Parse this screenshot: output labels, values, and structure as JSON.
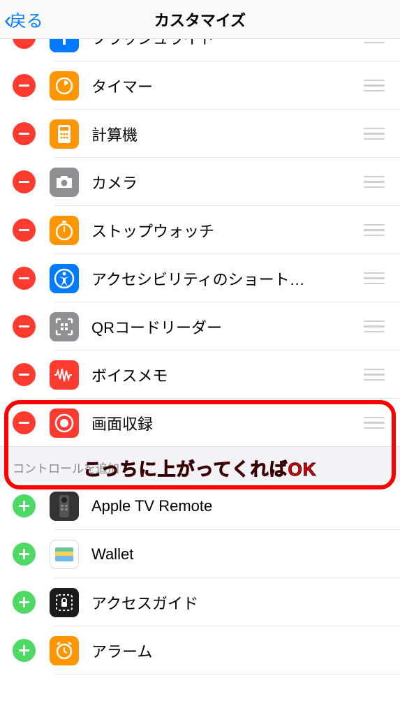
{
  "navbar": {
    "back": "戻る",
    "title": "カスタマイズ"
  },
  "callout_text": "こっちに上がってくればOK",
  "section_add_header": "コントロールを追加",
  "included": [
    {
      "label": "フラッシュライト",
      "icon": "flashlight",
      "bg": "ic-blue"
    },
    {
      "label": "タイマー",
      "icon": "timer",
      "bg": "ic-orange"
    },
    {
      "label": "計算機",
      "icon": "calculator",
      "bg": "ic-orange"
    },
    {
      "label": "カメラ",
      "icon": "camera",
      "bg": "ic-gray"
    },
    {
      "label": "ストップウォッチ",
      "icon": "stopwatch",
      "bg": "ic-orange"
    },
    {
      "label": "アクセシビリティのショート…",
      "icon": "accessibility",
      "bg": "ic-blue"
    },
    {
      "label": "QRコードリーダー",
      "icon": "qr",
      "bg": "ic-gray"
    },
    {
      "label": "ボイスメモ",
      "icon": "voice",
      "bg": "ic-red"
    },
    {
      "label": "画面収録",
      "icon": "screenrec",
      "bg": "ic-red"
    }
  ],
  "more": [
    {
      "label": "Apple TV Remote",
      "icon": "tvremote",
      "bg": "ic-dark"
    },
    {
      "label": "Wallet",
      "icon": "wallet",
      "bg": "ic-white"
    },
    {
      "label": "アクセスガイド",
      "icon": "accessguide",
      "bg": "ic-black"
    },
    {
      "label": "アラーム",
      "icon": "alarm",
      "bg": "ic-orange"
    }
  ]
}
